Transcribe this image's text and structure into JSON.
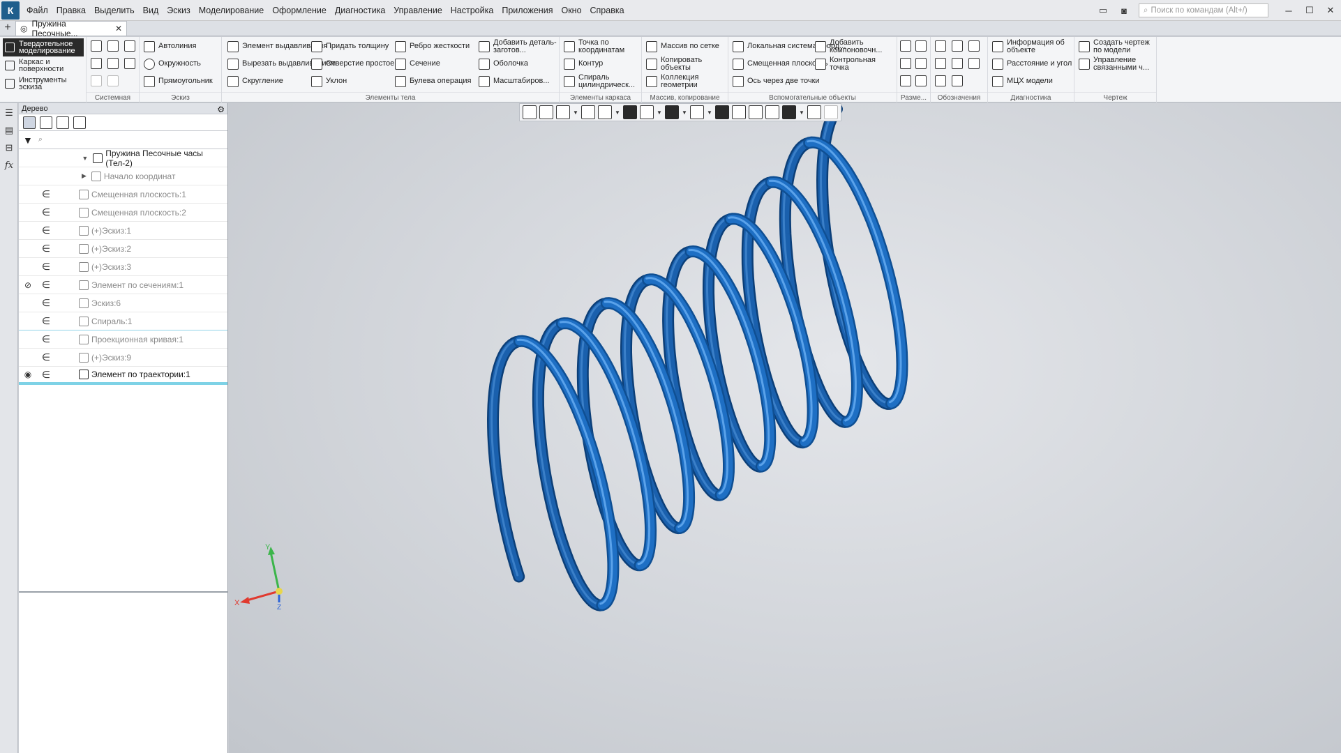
{
  "menubar": {
    "items": [
      "Файл",
      "Правка",
      "Выделить",
      "Вид",
      "Эскиз",
      "Моделирование",
      "Оформление",
      "Диагностика",
      "Управление",
      "Настройка",
      "Приложения",
      "Окно",
      "Справка"
    ],
    "search_placeholder": "Поиск по командам (Alt+/)"
  },
  "tabs": {
    "doc_tab_label": "Пружина Песочные..."
  },
  "ribbon": {
    "modes": [
      "Твердотельное моделирование",
      "Каркас и поверхности",
      "Инструменты эскиза"
    ],
    "groups": {
      "system": "Системная",
      "sketch": "Эскиз",
      "body": "Элементы тела",
      "frame": "Элементы каркаса",
      "array": "Массив, копирование",
      "aux": "Вспомогательные объекты",
      "dims": "Разме...",
      "marks": "Обозначения",
      "diag": "Диагностика",
      "drawing": "Чертеж"
    },
    "sketch_buttons": [
      "Автолиния",
      "Окружность",
      "Прямоугольник"
    ],
    "body_buttons": [
      "Элемент выдавливания",
      "Вырезать выдавливанием",
      "Скругление",
      "Придать толщину",
      "Отверстие простое",
      "Уклон",
      "Ребро жесткости",
      "Сечение",
      "Булева операция",
      "Добавить деталь-заготов...",
      "Оболочка",
      "Масштабиров..."
    ],
    "frame_buttons": [
      "Точка по координатам",
      "Контур",
      "Спираль цилиндрическ..."
    ],
    "array_buttons": [
      "Массив по сетке",
      "Копировать объекты",
      "Коллекция геометрии"
    ],
    "aux_buttons": [
      "Локальная система коорд...",
      "Смещенная плоскость",
      "Ось через две точки",
      "Добавить компоновочн...",
      "Контрольная точка"
    ],
    "diag_buttons": [
      "Информация об объекте",
      "Расстояние и угол",
      "МЦХ модели"
    ],
    "drawing_buttons": [
      "Создать чертеж по модели",
      "Управление связанными ч..."
    ]
  },
  "tree": {
    "header": "Дерево",
    "root": "Пружина Песочные часы (Тел-2)",
    "items": [
      {
        "label": "Начало координат",
        "expandable": true,
        "status": "",
        "icon": "origin-icon"
      },
      {
        "label": "Смещенная плоскость:1",
        "status": "∈",
        "icon": "plane-icon"
      },
      {
        "label": "Смещенная плоскость:2",
        "status": "∈",
        "icon": "plane-icon"
      },
      {
        "label": "(+)Эскиз:1",
        "status": "∈",
        "icon": "sketch-icon"
      },
      {
        "label": "(+)Эскиз:2",
        "status": "∈",
        "icon": "sketch-icon"
      },
      {
        "label": "(+)Эскиз:3",
        "status": "∈",
        "icon": "sketch-icon"
      },
      {
        "label": "Элемент по сечениям:1",
        "status": "∈",
        "icon": "loft-icon",
        "visibility": "hidden-eye"
      },
      {
        "label": "Эскиз:6",
        "status": "∈",
        "icon": "sketch-icon"
      },
      {
        "label": "Спираль:1",
        "status": "∈",
        "icon": "spiral-icon"
      },
      {
        "label": "Проекционная кривая:1",
        "status": "∈",
        "icon": "curve-icon"
      },
      {
        "label": "(+)Эскиз:9",
        "status": "∈",
        "icon": "sketch-icon"
      },
      {
        "label": "Элемент по траектории:1",
        "status": "∈",
        "icon": "sweep-icon",
        "visibility": "eye",
        "active": true
      }
    ]
  },
  "viewport": {
    "model_color": "#1e6fc4",
    "axes": {
      "x": "X",
      "y": "Y",
      "z": "Z"
    }
  }
}
